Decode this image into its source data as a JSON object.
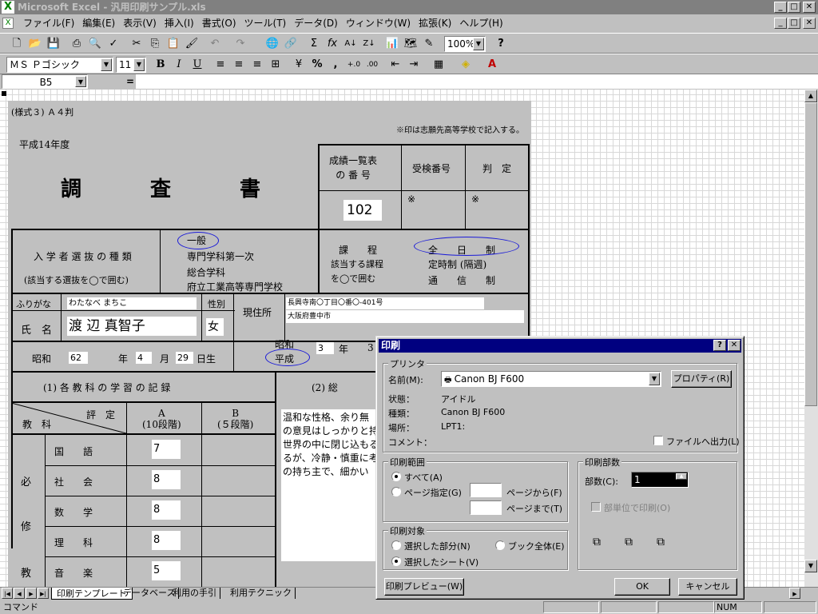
{
  "window": {
    "title": "Microsoft Excel - 汎用印刷サンプル.xls",
    "min": "_",
    "max": "□",
    "close": "✕"
  },
  "menu": [
    "ファイル(F)",
    "編集(E)",
    "表示(V)",
    "挿入(I)",
    "書式(O)",
    "ツール(T)",
    "データ(D)",
    "ウィンドウ(W)",
    "拡張(K)",
    "ヘルプ(H)"
  ],
  "toolbar": {
    "zoom": "100%",
    "font": "ＭＳ Ｐゴシック",
    "size": "11",
    "bold": "B",
    "italic": "I",
    "underline": "U",
    "percent": "%",
    "comma": ","
  },
  "formula": {
    "namebox": "B5",
    "equals": "="
  },
  "form": {
    "header_left": "(様式３)  Ａ４判",
    "note": "※印は志願先高等学校で記入する。",
    "year": "平成14年度",
    "title": "調　　　査　　　書",
    "col_seiseki": "成績一覧表\nの 番 号",
    "col_juken": "受検番号",
    "col_hantei": "判　定",
    "seiseki_no": "102",
    "mark1": "※",
    "mark2": "※",
    "nyugaku_title": "入 学 者 選 抜 の 種 類",
    "nyugaku_sub": "(該当する選抜を◯で囲む)",
    "senbatsu": [
      "一般",
      "専門学科第一次",
      "総合学科",
      "府立工業高等専門学校"
    ],
    "katei_title": "課　　程",
    "katei_sub1": "該当する課程",
    "katei_sub2": "を◯で囲む",
    "katei": [
      "全　　日　　制",
      "定時制 (隔週)",
      "通　　信　　制"
    ],
    "furigana_label": "ふりがな",
    "furigana": "わたなべ まちこ",
    "seibetsu_label": "性別",
    "shimei_label": "氏　名",
    "shimei": "渡 辺 真智子",
    "sex": "女",
    "genjusho_label": "現住所",
    "addr1": "長興寺南〇丁目〇番〇-401号",
    "addr2": "大阪府豊中市",
    "showa": "昭和",
    "birth_y": "62",
    "nen": "年",
    "birth_m": "4",
    "tsuki": "月",
    "birth_d": "29",
    "nichi": "日生",
    "showa2": "昭和",
    "heisei": "平成",
    "grad_y": "3",
    "nen2": "年",
    "grad_m": "3",
    "sec1": "(1)  各 教 科 の 学 習 の 記 録",
    "sec2": "(2)  総",
    "hyotei": "評　定",
    "kyoka": "教　科",
    "colA": "A\n(10段階)",
    "colB": "B\n(５段階)",
    "hisshu1": "必",
    "hisshu2": "修",
    "hisshu3": "教",
    "subjects": [
      {
        "name": "国　　語",
        "a": "7"
      },
      {
        "name": "社　　会",
        "a": "8"
      },
      {
        "name": "数　　学",
        "a": "8"
      },
      {
        "name": "理　　科",
        "a": "8"
      },
      {
        "name": "音　　楽",
        "a": "5"
      }
    ],
    "comment": " 温和な性格、余り無\nの意見はしっかりと持\n世界の中に閉じ込もる\nるが、冷静・慎重に考\nの持ち主で、細かい"
  },
  "dialog": {
    "title": "印刷",
    "help": "?",
    "close": "✕",
    "printer_group": "プリンタ",
    "name_label": "名前(M):",
    "printer_name": "Canon BJ F600",
    "properties": "プロパティ(R)",
    "status_label": "状態：",
    "status": "アイドル",
    "type_label": "種類：",
    "type": "Canon BJ F600",
    "where_label": "場所：",
    "where": "LPT1:",
    "comment_label": "コメント：",
    "to_file": "ファイルへ出力(L)",
    "range_group": "印刷範囲",
    "all": "すべて(A)",
    "pages": "ページ指定(G)",
    "from": "ページから(F)",
    "to": "ページまで(T)",
    "copies_group": "印刷部数",
    "copies_label": "部数(C):",
    "copies": "1",
    "collate": "部単位で印刷(O)",
    "what_group": "印刷対象",
    "selection": "選択した部分(N)",
    "workbook": "ブック全体(E)",
    "sheets": "選択したシート(V)",
    "preview": "印刷プレビュー(W)",
    "ok": "OK",
    "cancel": "キャンセル"
  },
  "tabs": [
    "印刷テンプレート",
    "データベース",
    "利用の手引",
    "利用テクニック"
  ],
  "status": {
    "mode": "コマンド",
    "num": "NUM"
  }
}
